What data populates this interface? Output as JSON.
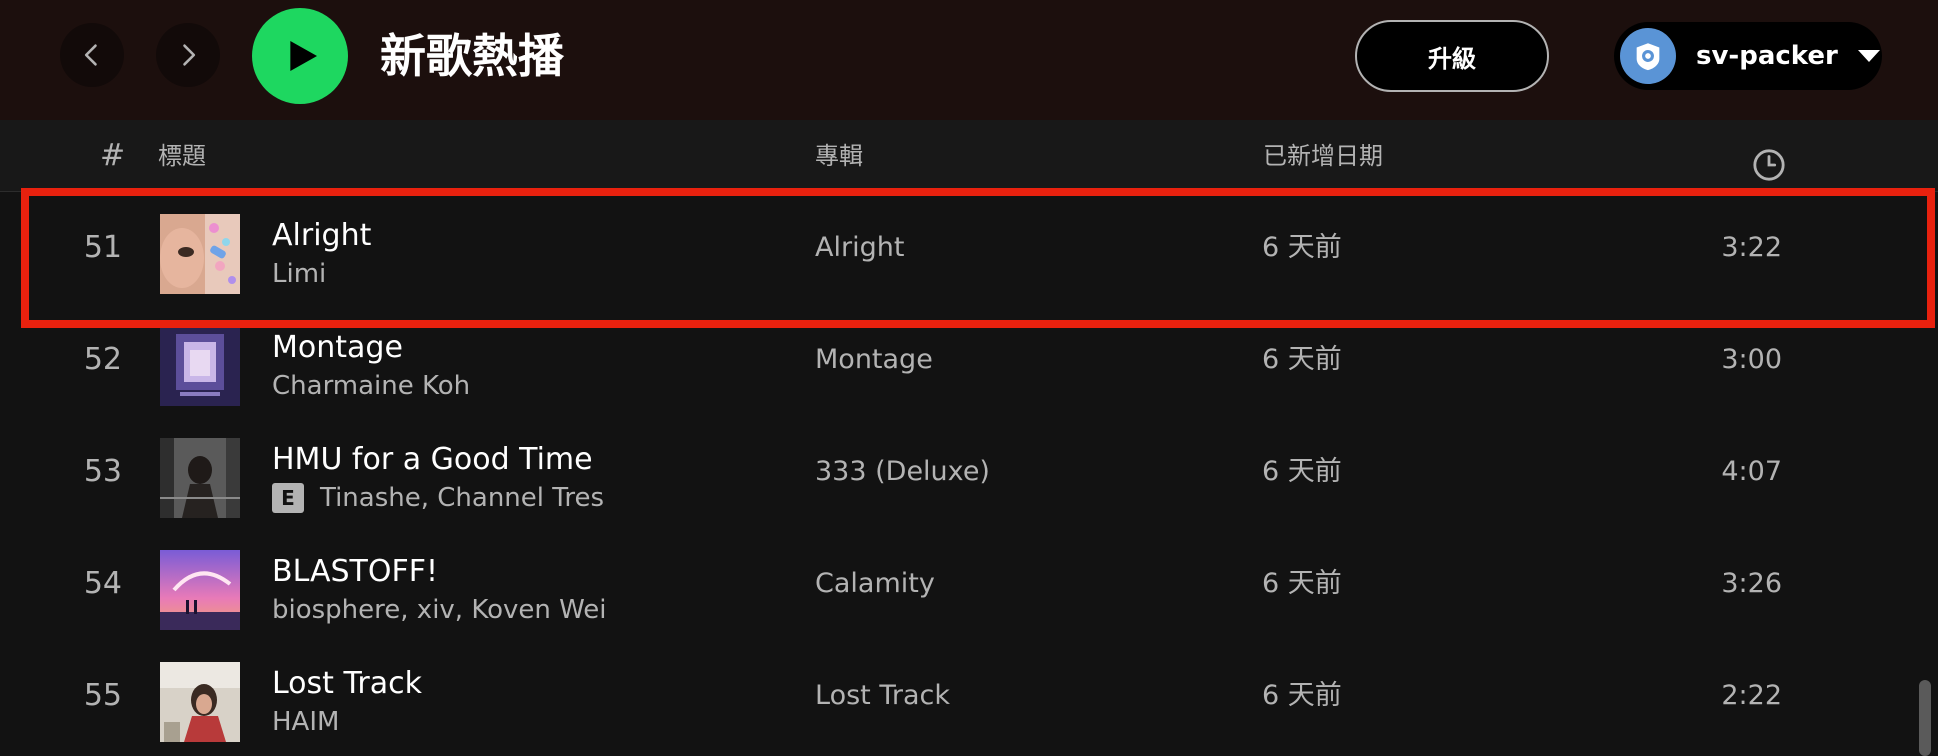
{
  "header": {
    "playlist_title": "新歌熱播",
    "upgrade_label": "升級",
    "username": "sv-packer"
  },
  "columns": {
    "number": "#",
    "title": "標題",
    "album": "專輯",
    "date_added": "已新增日期"
  },
  "icons": {
    "back": "chevron-left-icon",
    "forward": "chevron-right-icon",
    "play": "play-icon",
    "avatar": "user-avatar-icon",
    "dropdown": "caret-down-icon",
    "duration": "clock-icon"
  },
  "colors": {
    "accent": "#1ed760",
    "highlight": "#e8210e",
    "background": "#121212",
    "topbar": "#1c0f0d"
  },
  "tracks": [
    {
      "number": "51",
      "title": "Alright",
      "artist": "Limi",
      "explicit": false,
      "album": "Alright",
      "date_added": "6 天前",
      "duration": "3:22",
      "highlighted": true
    },
    {
      "number": "52",
      "title": "Montage",
      "artist": "Charmaine Koh",
      "explicit": false,
      "album": "Montage",
      "date_added": "6 天前",
      "duration": "3:00",
      "highlighted": false
    },
    {
      "number": "53",
      "title": "HMU for a Good Time",
      "artist": "Tinashe, Channel Tres",
      "explicit": true,
      "explicit_label": "E",
      "album": "333 (Deluxe)",
      "date_added": "6 天前",
      "duration": "4:07",
      "highlighted": false
    },
    {
      "number": "54",
      "title": "BLASTOFF!",
      "artist": "biosphere, xiv, Koven Wei",
      "explicit": false,
      "album": "Calamity",
      "date_added": "6 天前",
      "duration": "3:26",
      "highlighted": false
    },
    {
      "number": "55",
      "title": "Lost Track",
      "artist": "HAIM",
      "explicit": false,
      "album": "Lost Track",
      "date_added": "6 天前",
      "duration": "2:22",
      "highlighted": false
    }
  ]
}
